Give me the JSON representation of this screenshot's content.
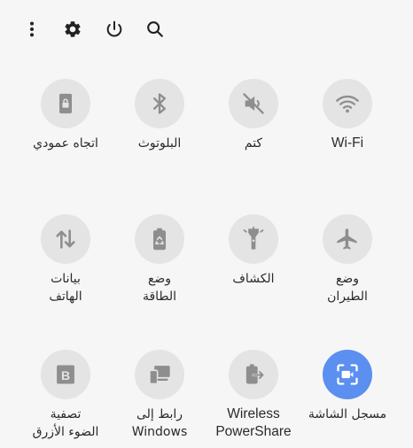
{
  "header": {
    "icons": [
      "more-vert-icon",
      "gear-icon",
      "power-icon",
      "search-icon"
    ]
  },
  "tiles": [
    {
      "label": "Wi-Fi",
      "icon": "wifi-icon",
      "active": false
    },
    {
      "label": "كتم",
      "icon": "mute-icon",
      "active": false
    },
    {
      "label": "البلوتوث",
      "icon": "bluetooth-icon",
      "active": false
    },
    {
      "label": "اتجاه عمودي",
      "icon": "portrait-lock-icon",
      "active": false
    },
    {
      "label": "وضع\nالطيران",
      "icon": "airplane-icon",
      "active": false
    },
    {
      "label": "الكشاف",
      "icon": "flashlight-icon",
      "active": false
    },
    {
      "label": "وضع\nالطاقة",
      "icon": "power-mode-icon",
      "active": false
    },
    {
      "label": "بيانات\nالهاتف",
      "icon": "mobile-data-icon",
      "active": false
    },
    {
      "label": "مسجل الشاشة",
      "icon": "screen-recorder-icon",
      "active": true
    },
    {
      "label": "Wireless\nPowerShare",
      "icon": "wireless-powershare-icon",
      "active": false
    },
    {
      "label": "رابط إلى\nWindows",
      "icon": "link-to-windows-icon",
      "active": false
    },
    {
      "label": "تصفية\nالضوء الأزرق",
      "icon": "blue-light-filter-icon",
      "active": false
    }
  ],
  "colors": {
    "background": "#f6f6f6",
    "tile_inactive": "#e4e4e4",
    "tile_active": "#5b8ff0",
    "icon_inactive": "#8e8e8e",
    "icon_active": "#ffffff",
    "text": "#2a2a2a"
  }
}
